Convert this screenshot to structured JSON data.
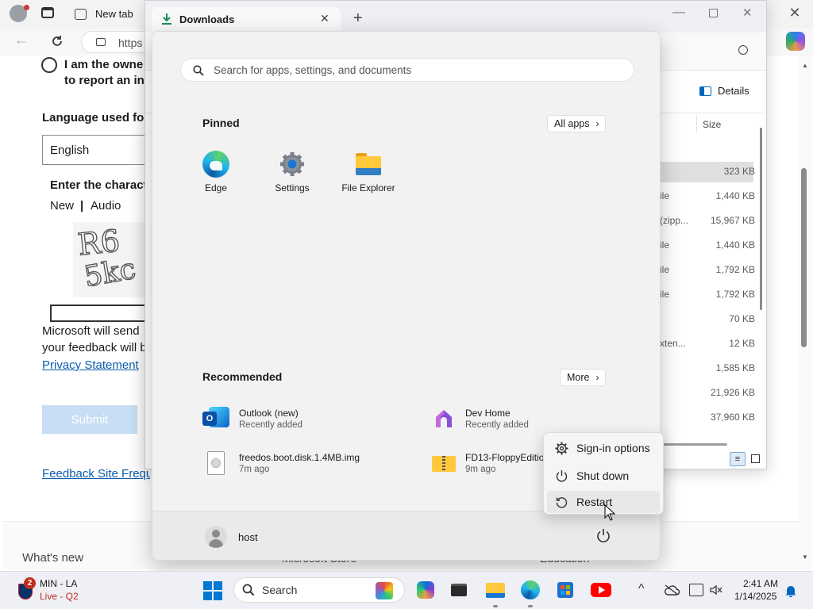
{
  "browser": {
    "tab_title": "New tab",
    "address_prefix": "https",
    "radio_text_line1": "I am the owne",
    "radio_text_line2": "to report an in",
    "language_label": "Language used for",
    "language_value": "English",
    "captcha_heading": "Enter the charact",
    "captcha_new": "New",
    "captcha_sep": "|",
    "captcha_audio": "Audio",
    "captcha_text_top": "R6",
    "captcha_text_bottom": "5kc",
    "notice_line1": "Microsoft will send",
    "notice_line2": "your feedback will b",
    "privacy_link": "Privacy Statement",
    "submit_label": "Submit",
    "feedback_link": "Feedback Site Freque",
    "whats_new": "What's new",
    "bottom_store": "Microsoft Store",
    "bottom_education": "Education"
  },
  "explorer": {
    "tab_title": "Downloads",
    "new_tab": "+",
    "details_label": "Details",
    "size_header": "Size",
    "rows": [
      {
        "type": "",
        "size": "323 KB"
      },
      {
        "type": "ile",
        "size": "1,440 KB"
      },
      {
        "type": "(zipp...",
        "size": "15,967 KB"
      },
      {
        "type": "ile",
        "size": "1,440 KB"
      },
      {
        "type": "ile",
        "size": "1,792 KB"
      },
      {
        "type": "ile",
        "size": "1,792 KB"
      },
      {
        "type": "",
        "size": "70 KB"
      },
      {
        "type": "xten...",
        "size": "12 KB"
      },
      {
        "type": "",
        "size": "1,585 KB"
      },
      {
        "type": "",
        "size": "21,926 KB"
      },
      {
        "type": "",
        "size": "37,960 KB"
      }
    ]
  },
  "start": {
    "search_placeholder": "Search for apps, settings, and documents",
    "pinned_title": "Pinned",
    "all_apps_label": "All apps",
    "pinned_apps": [
      {
        "label": "Edge",
        "icon": "edge-icon"
      },
      {
        "label": "Settings",
        "icon": "settings-icon"
      },
      {
        "label": "File Explorer",
        "icon": "file-explorer-icon"
      }
    ],
    "recommended_title": "Recommended",
    "more_label": "More",
    "recommended": [
      {
        "name": "Outlook (new)",
        "sub": "Recently added",
        "icon": "outlook-icon"
      },
      {
        "name": "Dev Home",
        "sub": "Recently added",
        "icon": "dev-home-icon"
      },
      {
        "name": "freedos.boot.disk.1.4MB.img",
        "sub": "7m ago",
        "icon": "disk-image-icon"
      },
      {
        "name": "FD13-FloppyEditio",
        "sub": "9m ago",
        "icon": "zip-folder-icon"
      }
    ],
    "user_name": "host"
  },
  "power_menu": {
    "items": [
      {
        "label": "Sign-in options",
        "icon": "gear-icon"
      },
      {
        "label": "Shut down",
        "icon": "power-icon"
      },
      {
        "label": "Restart",
        "icon": "restart-icon"
      }
    ]
  },
  "taskbar": {
    "weather_badge": "2",
    "weather_title": "MIN - LA",
    "weather_sub": "Live - Q2",
    "search_label": "Search",
    "time": "2:41 AM",
    "date": "1/14/2025",
    "accent": "#0067c0"
  }
}
